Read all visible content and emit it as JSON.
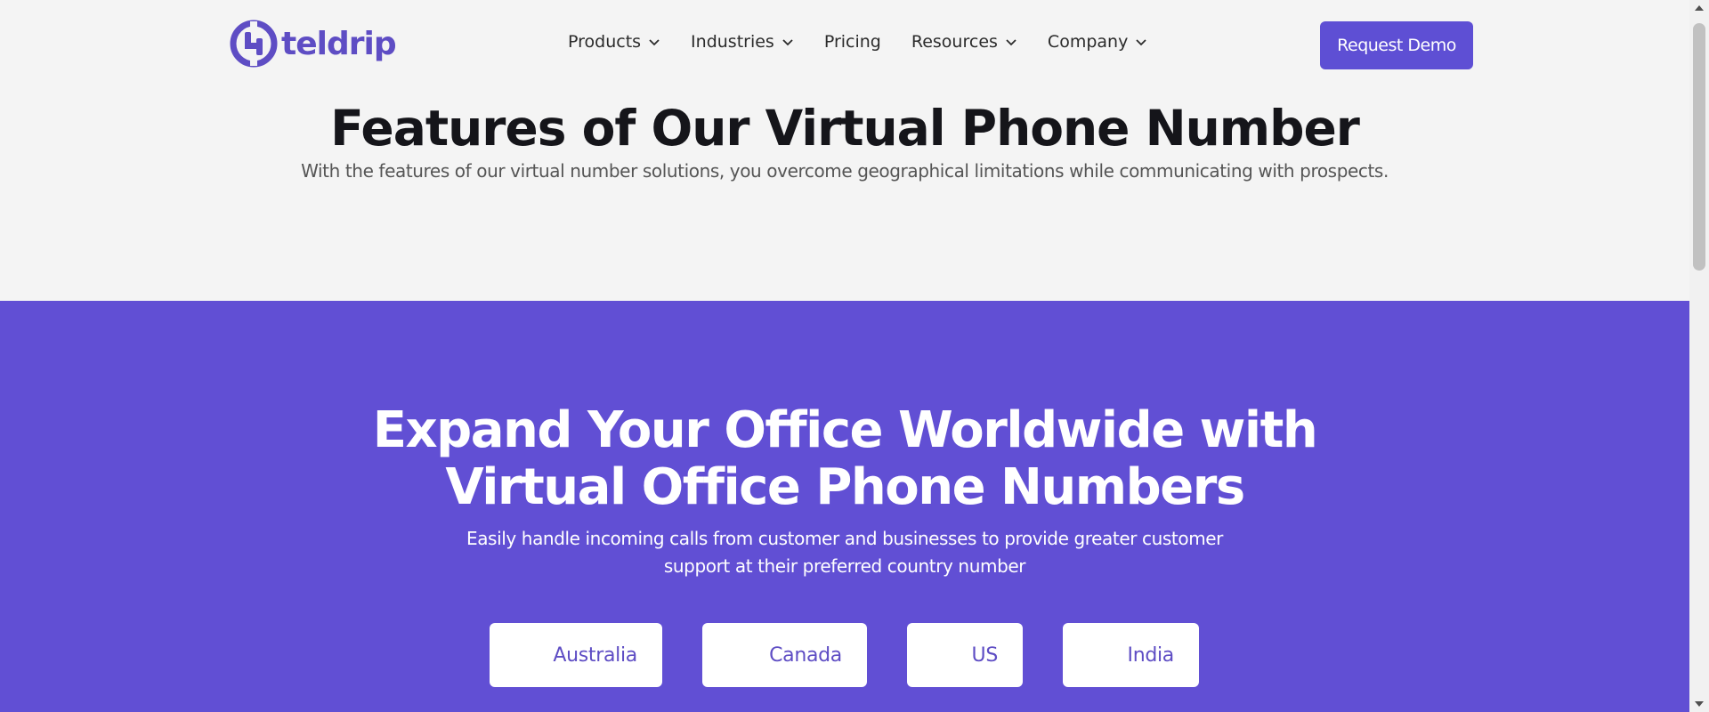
{
  "brand": {
    "name": "teldrip",
    "color": "#5e4dc4"
  },
  "nav": {
    "items": [
      {
        "label": "Products",
        "has_dropdown": true
      },
      {
        "label": "Industries",
        "has_dropdown": true
      },
      {
        "label": "Pricing",
        "has_dropdown": false
      },
      {
        "label": "Resources",
        "has_dropdown": true
      },
      {
        "label": "Company",
        "has_dropdown": true
      }
    ],
    "cta_label": "Request Demo"
  },
  "features": {
    "title": "Features of Our Virtual Phone Number",
    "subtitle": "With the features of our virtual number solutions, you overcome geographical limitations while communicating with prospects."
  },
  "expand": {
    "title_line1": "Expand Your Office Worldwide with",
    "title_line2": "Virtual Office Phone Numbers",
    "subtitle_line1": "Easily handle incoming calls from customer and businesses to provide greater customer",
    "subtitle_line2": "support at their preferred country number",
    "countries": [
      "Australia",
      "Canada",
      "US",
      "India"
    ]
  },
  "colors": {
    "accent": "#5e4fd4",
    "band": "#614fd4",
    "page_bg": "#f4f4f4"
  }
}
